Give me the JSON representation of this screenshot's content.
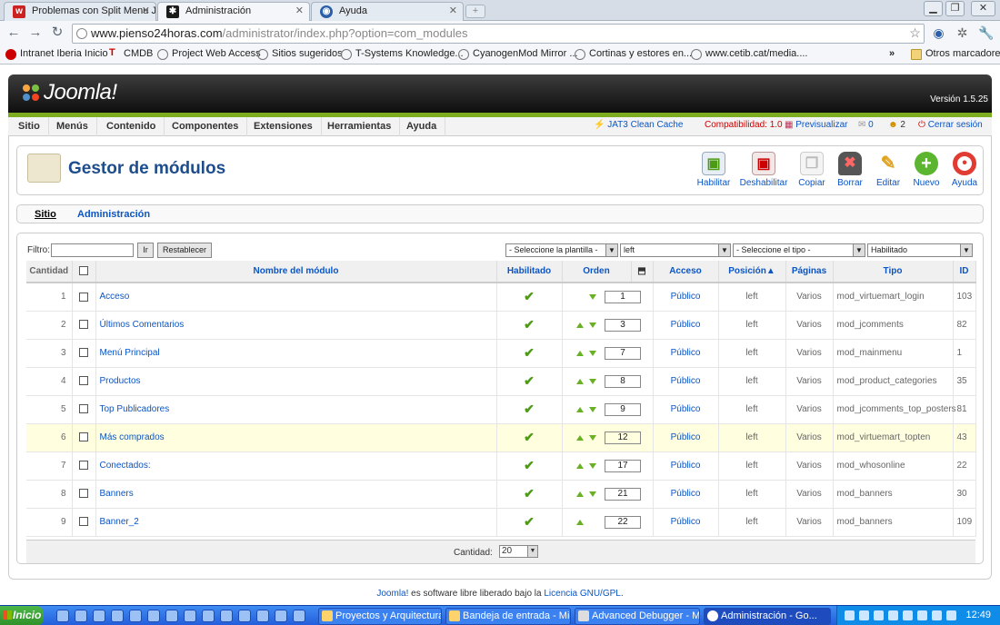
{
  "browser": {
    "tabs": [
      {
        "title": "Problemas con Split Menu JA Z",
        "icon": "w-icon",
        "icon_color": "#cc2222",
        "active": false
      },
      {
        "title": "Administración",
        "icon": "joomla-icon",
        "icon_color": "#1a1a1a",
        "active": true
      },
      {
        "title": "Ayuda",
        "icon": "globe-icon",
        "icon_color": "#2b5fa8",
        "active": false
      }
    ],
    "url_domain": "www.pienso24horas.com",
    "url_path": "/administrator/index.php?option=com_modules",
    "bookmarks": [
      "Intranet Iberia Inicio",
      "CMDB",
      "Project Web Access",
      "Sitios sugeridos",
      "T-Systems Knowledge...",
      "CyanogenMod Mirror ...",
      "Cortinas y estores en...",
      "www.cetib.cat/media...."
    ],
    "other_bookmarks": "Otros marcadores",
    "overflow": "»"
  },
  "joomla": {
    "logo_text": "Joomla!",
    "version": "Versión 1.5.25",
    "menu": [
      "Sitio",
      "Menús",
      "Contenido",
      "Componentes",
      "Extensiones",
      "Herramientas",
      "Ayuda"
    ],
    "status": {
      "cache": "JAT3 Clean Cache",
      "compat": "Compatibilidad: 1.0",
      "preview": "Previsualizar",
      "messages": "0",
      "users": "2",
      "logout": "Cerrar sesión"
    },
    "page_title": "Gestor de módulos",
    "toolbar": [
      {
        "label": "Habilitar",
        "icon": "enable-icon"
      },
      {
        "label": "Deshabilitar",
        "icon": "disable-icon"
      },
      {
        "label": "Copiar",
        "icon": "copy-icon"
      },
      {
        "label": "Borrar",
        "icon": "delete-icon"
      },
      {
        "label": "Editar",
        "icon": "edit-icon"
      },
      {
        "label": "Nuevo",
        "icon": "new-icon"
      },
      {
        "label": "Ayuda",
        "icon": "help-icon"
      }
    ],
    "subnav": [
      "Sitio",
      "Administración"
    ],
    "filter": {
      "label": "Filtro:",
      "value": "",
      "go": "Ir",
      "reset": "Restablecer",
      "template_select": "- Seleccione la plantilla -",
      "position_select": "left",
      "type_select": "- Seleccione el tipo -",
      "state_select": "Habilitado"
    },
    "columns": [
      "Cantidad",
      "Nombre del módulo",
      "Habilitado",
      "Orden",
      "Acceso",
      "Posición▲",
      "Páginas",
      "Tipo",
      "ID"
    ],
    "rows": [
      {
        "n": "1",
        "name": "Acceso",
        "order": "1",
        "access": "Público",
        "position": "left",
        "pages": "Varios",
        "type": "mod_virtuemart_login",
        "id": "103",
        "up": false,
        "down": true
      },
      {
        "n": "2",
        "name": "Últimos Comentarios",
        "order": "3",
        "access": "Público",
        "position": "left",
        "pages": "Varios",
        "type": "mod_jcomments",
        "id": "82",
        "up": true,
        "down": true
      },
      {
        "n": "3",
        "name": "Menú Principal",
        "order": "7",
        "access": "Público",
        "position": "left",
        "pages": "Varios",
        "type": "mod_mainmenu",
        "id": "1",
        "up": true,
        "down": true
      },
      {
        "n": "4",
        "name": "Productos",
        "order": "8",
        "access": "Público",
        "position": "left",
        "pages": "Varios",
        "type": "mod_product_categories",
        "id": "35",
        "up": true,
        "down": true
      },
      {
        "n": "5",
        "name": "Top Publicadores",
        "order": "9",
        "access": "Público",
        "position": "left",
        "pages": "Varios",
        "type": "mod_jcomments_top_posters",
        "id": "81",
        "up": true,
        "down": true
      },
      {
        "n": "6",
        "name": "Más comprados",
        "order": "12",
        "access": "Público",
        "position": "left",
        "pages": "Varios",
        "type": "mod_virtuemart_topten",
        "id": "43",
        "up": true,
        "down": true
      },
      {
        "n": "7",
        "name": "Conectados:",
        "order": "17",
        "access": "Público",
        "position": "left",
        "pages": "Varios",
        "type": "mod_whosonline",
        "id": "22",
        "up": true,
        "down": true
      },
      {
        "n": "8",
        "name": "Banners",
        "order": "21",
        "access": "Público",
        "position": "left",
        "pages": "Varios",
        "type": "mod_banners",
        "id": "30",
        "up": true,
        "down": true
      },
      {
        "n": "9",
        "name": "Banner_2",
        "order": "22",
        "access": "Público",
        "position": "left",
        "pages": "Varios",
        "type": "mod_banners",
        "id": "109",
        "up": true,
        "down": false
      }
    ],
    "limit_label": "Cantidad:",
    "limit_value": "20",
    "footer_link1": "Joomla!",
    "footer_text": "es software libre liberado bajo la",
    "footer_link2": "Licencia GNU/GPL",
    "footer_end": "."
  },
  "taskbar": {
    "start": "Inicio",
    "tasks": [
      "Proyectos y Arquitectura...",
      "Bandeja de entrada - Mic...",
      "Advanced Debugger - M...",
      "Administración - Go..."
    ],
    "clock": "12:49"
  }
}
